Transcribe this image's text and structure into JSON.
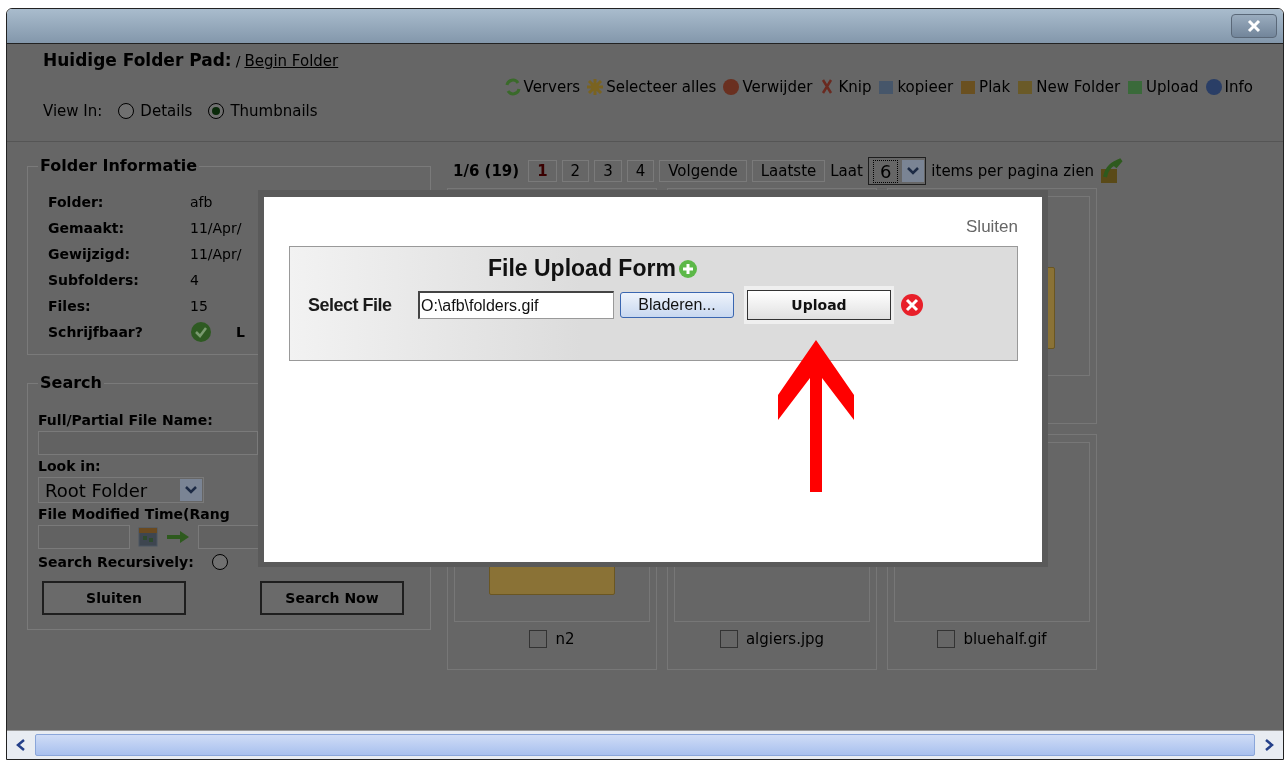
{
  "header": {
    "label": "Huidige Folder Pad:",
    "path_prefix": "/",
    "path_link": "Begin Folder"
  },
  "toolbar": [
    {
      "kind": "refresh",
      "label": "Ververs"
    },
    {
      "kind": "select-all",
      "label": "Selecteer alles"
    },
    {
      "kind": "delete",
      "label": "Verwijder"
    },
    {
      "kind": "cut",
      "label": "Knip"
    },
    {
      "kind": "copy",
      "label": "kopieer"
    },
    {
      "kind": "paste",
      "label": "Plak"
    },
    {
      "kind": "new-folder",
      "label": "New Folder"
    },
    {
      "kind": "upload",
      "label": "Upload"
    },
    {
      "kind": "info",
      "label": "Info"
    }
  ],
  "view_in": {
    "label": "View In:",
    "options": [
      {
        "label": "Details",
        "selected": false
      },
      {
        "label": "Thumbnails",
        "selected": true
      }
    ]
  },
  "folder_info": {
    "title": "Folder Informatie",
    "rows": [
      {
        "label": "Folder:",
        "value": "afb"
      },
      {
        "label": "Gemaakt:",
        "value": "11/Apr/"
      },
      {
        "label": "Gewijzigd:",
        "value": "11/Apr/"
      },
      {
        "label": "Subfolders:",
        "value": "4"
      },
      {
        "label": "Files:",
        "value": "15"
      },
      {
        "label": "Schrijfbaar?",
        "writable": true,
        "value": "L"
      }
    ]
  },
  "search": {
    "title": "Search",
    "name_label": "Full/Partial File Name:",
    "look_in_label": "Look in:",
    "look_in_value": "Root Folder",
    "time_label": "File Modified Time(Rang",
    "recursive_label": "Search Recursively:",
    "recursive_checked": false,
    "buttons": [
      "Sluiten",
      "Search Now"
    ]
  },
  "pager": {
    "summary": "1/6 (19)",
    "pages": [
      {
        "label": "1",
        "selected": true
      },
      {
        "label": "2",
        "selected": false
      },
      {
        "label": "3",
        "selected": false
      },
      {
        "label": "4",
        "selected": false
      }
    ],
    "next": "Volgende",
    "last": "Laatste",
    "show_prefix": "Laat",
    "per_page": "6",
    "show_suffix": "items per pagina zien"
  },
  "thumbnails": [
    {
      "kind": "blank"
    },
    {
      "kind": "blank"
    },
    {
      "kind": "folder"
    },
    {
      "kind": "folder",
      "caption": "n2",
      "checked": false
    },
    {
      "kind": "image",
      "caption": "algiers.jpg",
      "checked": false
    },
    {
      "kind": "image",
      "caption": "bluehalf.gif",
      "checked": false
    }
  ],
  "modal": {
    "close_link": "Sluiten",
    "form_title": "File Upload Form",
    "select_label": "Select File",
    "file_value": "O:\\afb\\folders.gif",
    "browse_button": "Bladeren...",
    "upload_button": "Upload"
  }
}
